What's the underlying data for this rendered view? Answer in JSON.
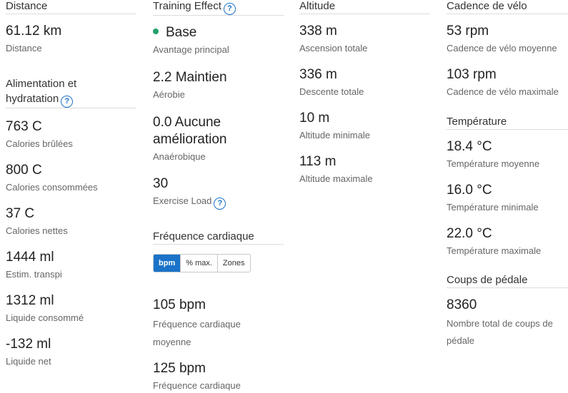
{
  "col1": {
    "distance_header": "Distance",
    "distance_value": "61.12 km",
    "distance_label": "Distance",
    "nutrition_header_line1": "Alimentation et",
    "nutrition_header_line2": "hydratation",
    "items": [
      {
        "value": "763 C",
        "label": "Calories brûlées"
      },
      {
        "value": "800 C",
        "label": "Calories consommées"
      },
      {
        "value": "37 C",
        "label": "Calories nettes"
      },
      {
        "value": "1444 ml",
        "label": "Estim. transpi"
      },
      {
        "value": "1312 ml",
        "label": "Liquide consommé"
      },
      {
        "value": "-132 ml",
        "label": "Liquide net"
      }
    ]
  },
  "col2": {
    "training_header": "Training Effect",
    "primary_value": "Base",
    "primary_label": "Avantage principal",
    "aerobic_value": "2.2 Maintien",
    "aerobic_label": "Aérobie",
    "anaerobic_value_line1": "0.0 Aucune",
    "anaerobic_value_line2": "amélioration",
    "anaerobic_label": "Anaérobique",
    "load_value": "30",
    "load_label": "Exercise Load",
    "hr_header": "Fréquence cardiaque",
    "hr_tabs": [
      "bpm",
      "% max.",
      "Zones"
    ],
    "hr_avg_value": "105 bpm",
    "hr_avg_label_line1": "Fréquence cardiaque",
    "hr_avg_label_line2": "moyenne",
    "hr_max_value": "125 bpm",
    "hr_max_label_line1": "Fréquence cardiaque"
  },
  "col3": {
    "altitude_header": "Altitude",
    "items": [
      {
        "value": "338 m",
        "label": "Ascension totale"
      },
      {
        "value": "336 m",
        "label": "Descente totale"
      },
      {
        "value": "10 m",
        "label": "Altitude minimale"
      },
      {
        "value": "113 m",
        "label": "Altitude maximale"
      }
    ]
  },
  "col4": {
    "cadence_header": "Cadence de vélo",
    "cadence_items": [
      {
        "value": "53 rpm",
        "label": "Cadence de vélo moyenne"
      },
      {
        "value": "103 rpm",
        "label": "Cadence de vélo maximale"
      }
    ],
    "temp_header": "Température",
    "temp_items": [
      {
        "value": "18.4 °C",
        "label": "Température moyenne"
      },
      {
        "value": "16.0 °C",
        "label": "Température minimale"
      },
      {
        "value": "22.0 °C",
        "label": "Température maximale"
      }
    ],
    "strokes_header": "Coups de pédale",
    "strokes_value": "8360",
    "strokes_label_line1": "Nombre total de coups de",
    "strokes_label_line2": "pédale"
  },
  "colors": {
    "accent": "#1a73c9",
    "base_dot": "#21a06a"
  },
  "icons": {
    "help": "help-circle-icon",
    "dot": "status-dot-icon"
  },
  "help_glyph": "?"
}
